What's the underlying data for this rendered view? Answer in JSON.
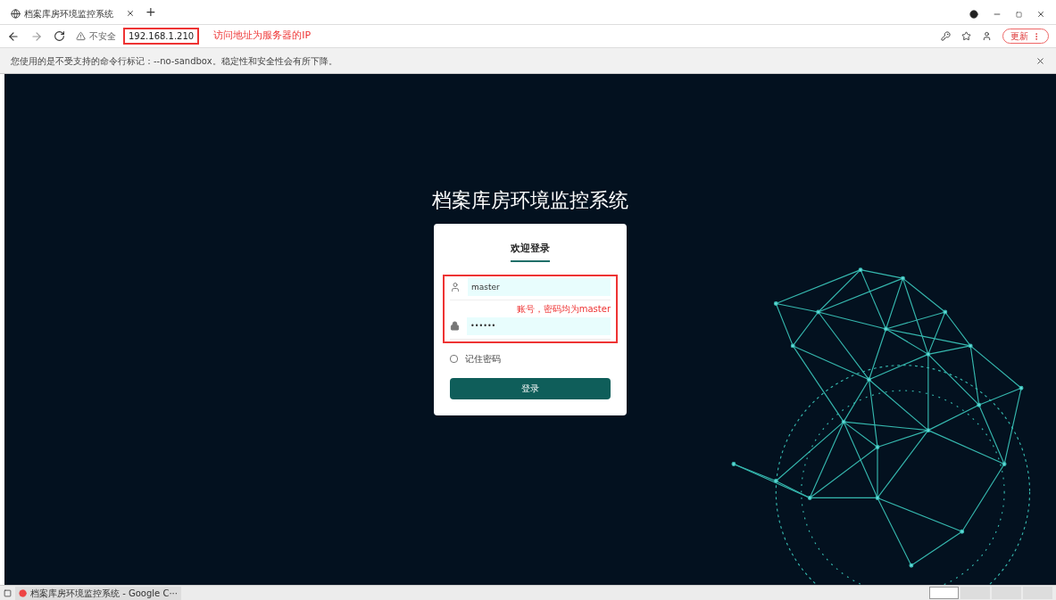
{
  "browser": {
    "tab_title": "档案库房环境监控系统",
    "new_tab": "+",
    "security": "不安全",
    "url": "192.168.1.210",
    "url_note": "访问地址为服务器的IP",
    "update_button": "更新"
  },
  "infobar": {
    "message": "您使用的是不受支持的命令行标记：--no-sandbox。稳定性和安全性会有所下降。"
  },
  "page": {
    "title": "档案库房环境监控系统",
    "login": {
      "heading": "欢迎登录",
      "username": "master",
      "password": "••••••",
      "note": "账号，密码均为master",
      "remember": {
        "label": "记住密码",
        "checked": false
      },
      "submit": "登录"
    }
  },
  "taskbar": {
    "window_title": "档案库房环境监控系统 - Google C···",
    "workspaces": [
      {
        "selected": true
      },
      {
        "selected": false
      },
      {
        "selected": false
      },
      {
        "selected": false
      }
    ]
  }
}
